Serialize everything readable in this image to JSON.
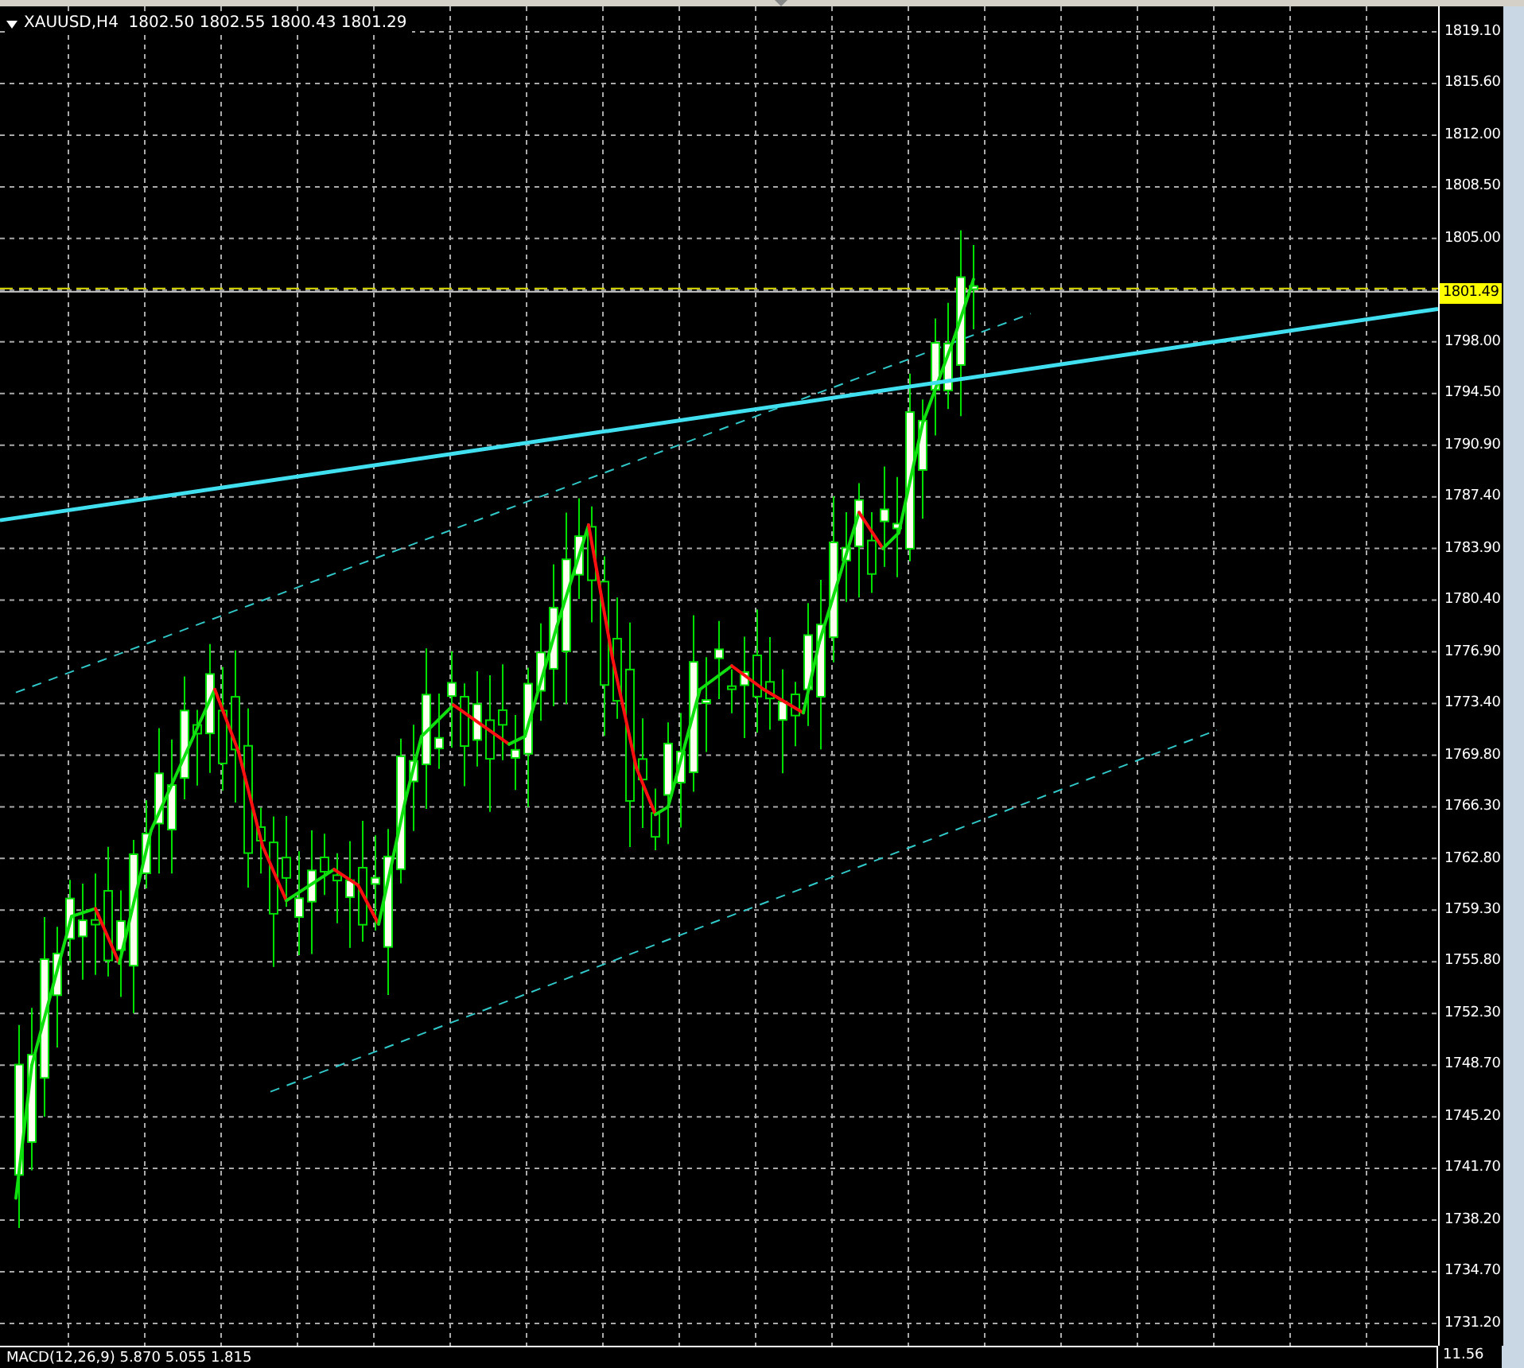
{
  "chart": {
    "header": "XAUUSD,H4  1802.50 1802.55 1800.43 1801.29",
    "price_scale": [
      "1819.10",
      "1815.60",
      "1812.00",
      "1808.50",
      "1805.00",
      "1798.00",
      "1794.50",
      "1790.90",
      "1787.40",
      "1783.90",
      "1780.40",
      "1776.90",
      "1773.40",
      "1769.80",
      "1766.30",
      "1762.80",
      "1759.30",
      "1755.80",
      "1752.30",
      "1748.70",
      "1745.20",
      "1741.70",
      "1738.20",
      "1734.70",
      "1731.20"
    ],
    "current_price": "1801.49"
  },
  "indicator_window": {
    "label": "MACD(12,26,9) 5.870 5.055 1.815",
    "scale_value": "11.56"
  }
}
